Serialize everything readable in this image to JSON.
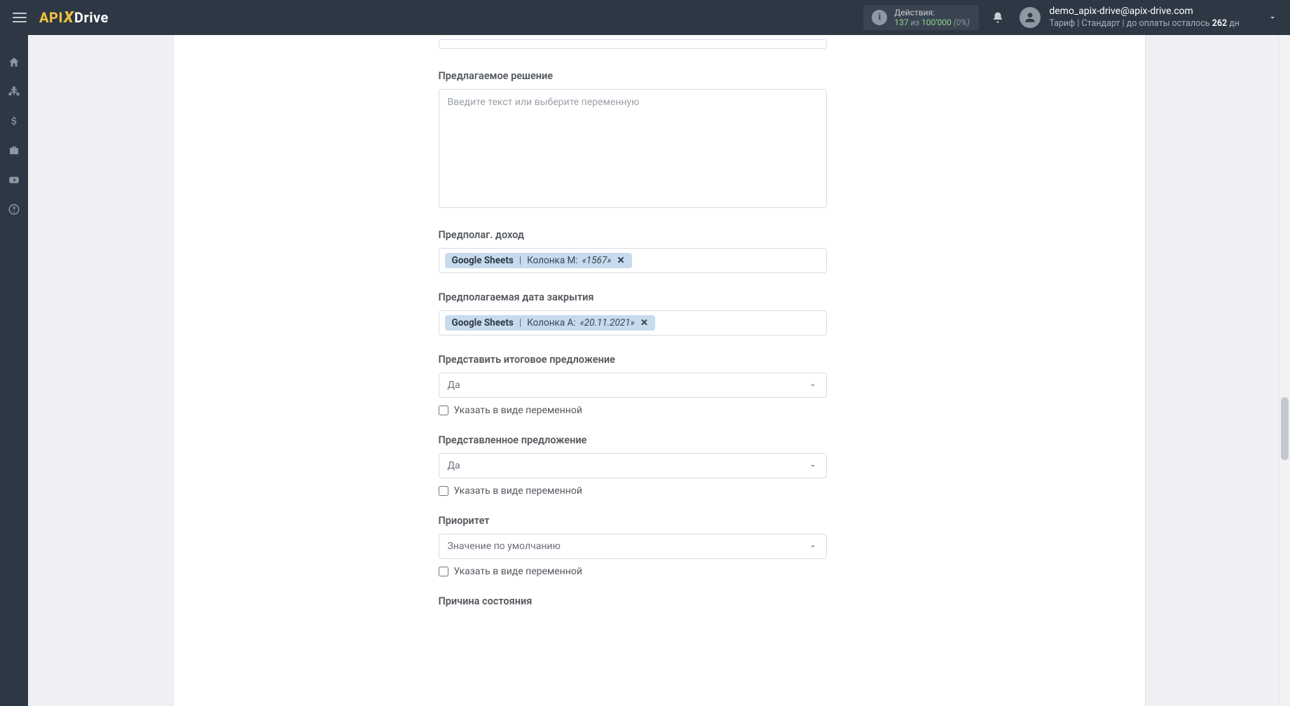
{
  "header": {
    "logo_api": "API",
    "logo_x": "X",
    "logo_drive": "Drive",
    "actions": {
      "title": "Действия:",
      "count": "137",
      "iz": "из",
      "total": "100'000",
      "percent": "(0%)"
    },
    "profile": {
      "email": "demo_apix-drive@apix-drive.com",
      "plan_prefix": "Тариф | Стандарт | до оплаты осталось ",
      "days": "262",
      "days_suffix": " дн"
    }
  },
  "form": {
    "f0": {
      "label": "Предлагаемое решение",
      "placeholder": "Введите текст или выберите переменную",
      "value": ""
    },
    "f1": {
      "label": "Предполаг. доход",
      "tag_source": "Google Sheets",
      "tag_column": "Колонка M:",
      "tag_value": "«1567»"
    },
    "f2": {
      "label": "Предполагаемая дата закрытия",
      "tag_source": "Google Sheets",
      "tag_column": "Колонка A:",
      "tag_value": "«20.11.2021»"
    },
    "f3": {
      "label": "Представить итоговое предложение",
      "selected": "Да",
      "checkbox": "Указать в виде переменной"
    },
    "f4": {
      "label": "Представленное предложение",
      "selected": "Да",
      "checkbox": "Указать в виде переменной"
    },
    "f5": {
      "label": "Приоритет",
      "selected": "Значение по умолчанию",
      "checkbox": "Указать в виде переменной"
    },
    "f6": {
      "label": "Причина состояния"
    }
  },
  "icons": {
    "home": "home-icon",
    "sitemap": "sitemap-icon",
    "dollar": "dollar-icon",
    "briefcase": "briefcase-icon",
    "youtube": "youtube-icon",
    "help": "help-icon"
  }
}
